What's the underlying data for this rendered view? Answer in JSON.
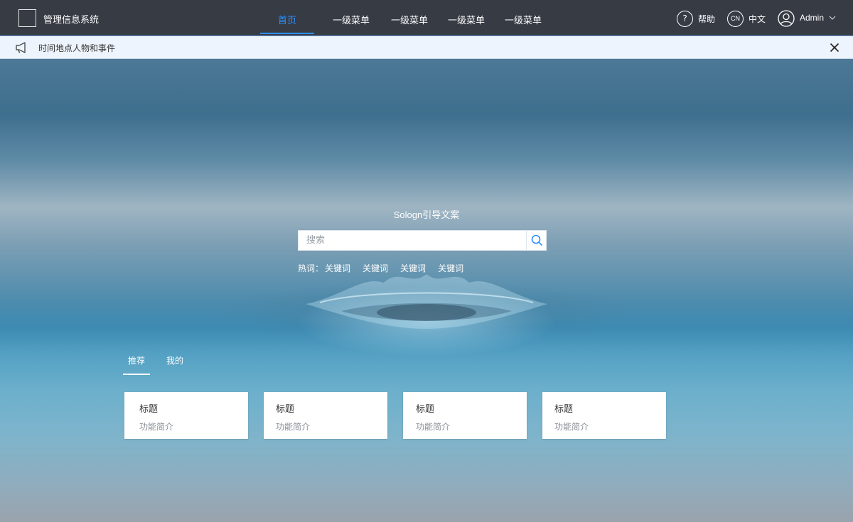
{
  "header": {
    "app_title": "管理信息系统",
    "nav": [
      "首页",
      "一级菜单",
      "一级菜单",
      "一级菜单",
      "一级菜单"
    ],
    "active_nav_color": "#2f8fff",
    "help_glyph": "?",
    "help_label": "帮助",
    "lang_code": "CN",
    "lang_label": "中文",
    "user_label": "Admin",
    "icons": {
      "help": "question-circle-icon",
      "lang": "language-cn-icon",
      "user": "user-circle-icon",
      "chevron": "chevron-down-icon"
    },
    "background": "#363b44"
  },
  "notice": {
    "text": "时间地点人物和事件",
    "icons": {
      "announce": "megaphone-icon",
      "close": "close-icon"
    }
  },
  "hero": {
    "guide_text": "Sologn引导文案",
    "search": {
      "placeholder": "搜索",
      "value": "",
      "icon": "search-icon"
    },
    "hot_label": "热词：",
    "hotwords": [
      "关键词",
      "关键词",
      "关键词",
      "关键词"
    ]
  },
  "tabs": [
    "推荐",
    "我的"
  ],
  "cards": [
    {
      "title": "标题",
      "desc": "功能简介"
    },
    {
      "title": "标题",
      "desc": "功能简介"
    },
    {
      "title": "标题",
      "desc": "功能简介"
    },
    {
      "title": "标题",
      "desc": "功能简介"
    }
  ]
}
